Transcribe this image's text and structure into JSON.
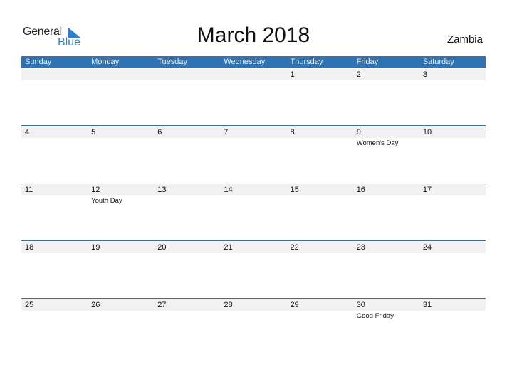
{
  "logo": {
    "word1": "General",
    "word2": "Blue"
  },
  "title": "March 2018",
  "country": "Zambia",
  "colors": {
    "header_bg": "#2f73b3",
    "accent": "#2a7fd4",
    "row_strip": "#f1f1f1"
  },
  "weekdays": [
    "Sunday",
    "Monday",
    "Tuesday",
    "Wednesday",
    "Thursday",
    "Friday",
    "Saturday"
  ],
  "weeks": [
    [
      {
        "day": ""
      },
      {
        "day": ""
      },
      {
        "day": ""
      },
      {
        "day": ""
      },
      {
        "day": "1"
      },
      {
        "day": "2"
      },
      {
        "day": "3"
      }
    ],
    [
      {
        "day": "4"
      },
      {
        "day": "5"
      },
      {
        "day": "6"
      },
      {
        "day": "7"
      },
      {
        "day": "8"
      },
      {
        "day": "9",
        "holiday": "Women's Day"
      },
      {
        "day": "10"
      }
    ],
    [
      {
        "day": "11"
      },
      {
        "day": "12",
        "holiday": "Youth Day"
      },
      {
        "day": "13"
      },
      {
        "day": "14"
      },
      {
        "day": "15"
      },
      {
        "day": "16"
      },
      {
        "day": "17"
      }
    ],
    [
      {
        "day": "18"
      },
      {
        "day": "19"
      },
      {
        "day": "20"
      },
      {
        "day": "21"
      },
      {
        "day": "22"
      },
      {
        "day": "23"
      },
      {
        "day": "24"
      }
    ],
    [
      {
        "day": "25"
      },
      {
        "day": "26"
      },
      {
        "day": "27"
      },
      {
        "day": "28"
      },
      {
        "day": "29"
      },
      {
        "day": "30",
        "holiday": "Good Friday"
      },
      {
        "day": "31"
      }
    ]
  ]
}
